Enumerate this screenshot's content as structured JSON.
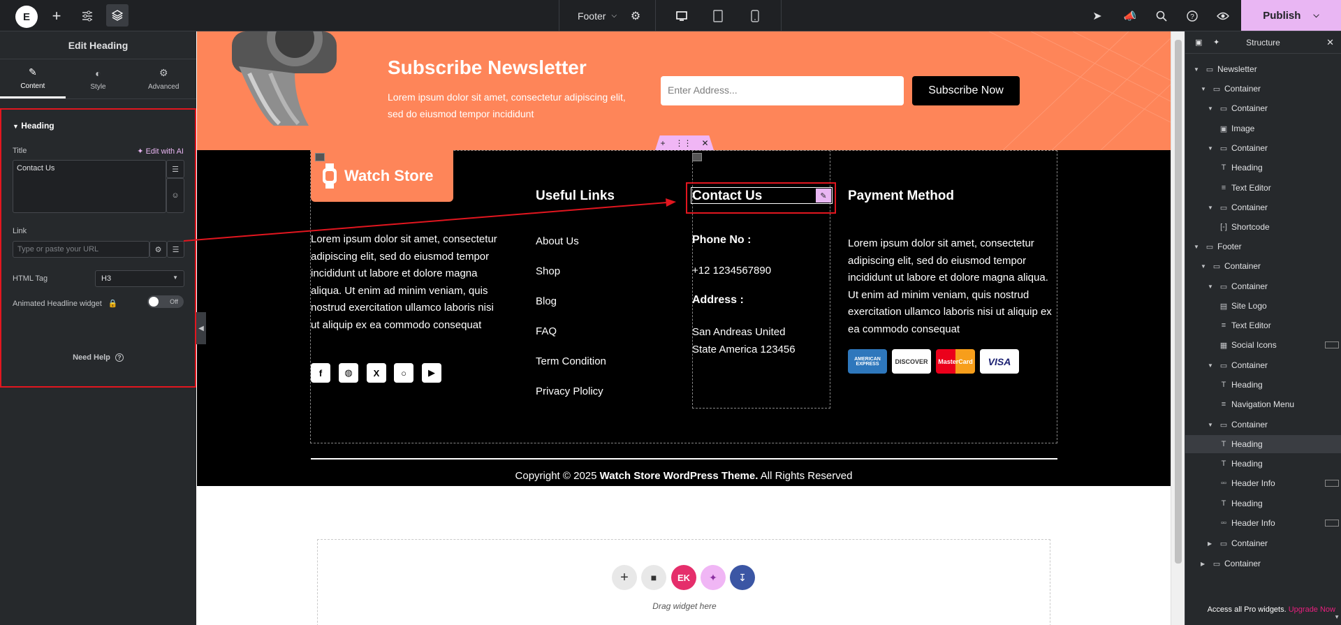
{
  "topbar": {
    "document_name": "Footer",
    "publish_label": "Publish"
  },
  "left_panel": {
    "title": "Edit Heading",
    "tabs": [
      {
        "label": "Content"
      },
      {
        "label": "Style"
      },
      {
        "label": "Advanced"
      }
    ],
    "section_title": "Heading",
    "title_label": "Title",
    "edit_ai_label": "Edit with AI",
    "title_value": "Contact Us",
    "link_label": "Link",
    "link_placeholder": "Type or paste your URL",
    "html_tag_label": "HTML Tag",
    "html_tag_value": "H3",
    "animated_label": "Animated Headline widget",
    "toggle_value": "Off",
    "need_help": "Need Help"
  },
  "structure": {
    "title": "Structure",
    "items": [
      {
        "label": "Newsletter"
      },
      {
        "label": "Container"
      },
      {
        "label": "Container"
      },
      {
        "label": "Image"
      },
      {
        "label": "Container"
      },
      {
        "label": "Heading"
      },
      {
        "label": "Text Editor"
      },
      {
        "label": "Container"
      },
      {
        "label": "Shortcode"
      },
      {
        "label": "Footer"
      },
      {
        "label": "Container"
      },
      {
        "label": "Container"
      },
      {
        "label": "Site Logo"
      },
      {
        "label": "Text Editor"
      },
      {
        "label": "Social Icons"
      },
      {
        "label": "Container"
      },
      {
        "label": "Heading"
      },
      {
        "label": "Navigation Menu"
      },
      {
        "label": "Container"
      },
      {
        "label": "Heading"
      },
      {
        "label": "Heading"
      },
      {
        "label": "Header Info"
      },
      {
        "label": "Heading"
      },
      {
        "label": "Header Info"
      },
      {
        "label": "Container"
      },
      {
        "label": "Container"
      }
    ],
    "footer_text": "Access all Pro widgets.",
    "upgrade_link": "Upgrade Now"
  },
  "newsletter": {
    "title": "Subscribe Newsletter",
    "text": "Lorem ipsum dolor sit amet, consectetur adipiscing elit, sed do eiusmod tempor incididunt",
    "input_placeholder": "Enter Address...",
    "button_label": "Subscribe Now"
  },
  "footer": {
    "logo_text": "Watch Store",
    "about_text": "Lorem ipsum dolor sit amet, consectetur adipiscing elit, sed do eiusmod tempor incididunt ut labore et dolore magna aliqua. Ut enim ad minim veniam, quis nostrud exercitation ullamco laboris nisi ut aliquip ex ea commodo consequat",
    "useful_links_title": "Useful Links",
    "links": [
      "About Us",
      "Shop",
      "Blog",
      "FAQ",
      "Term Condition",
      "Privacy Plolicy"
    ],
    "contact_title": "Contact Us",
    "phone_label": "Phone No :",
    "phone_value": "+12 1234567890",
    "address_label": "Address :",
    "address_value": "San Andreas United State America 123456",
    "payment_title": "Payment Method",
    "payment_text": "Lorem ipsum dolor sit amet, consectetur adipiscing elit, sed do eiusmod tempor incididunt ut labore et dolore magna aliqua. Ut enim ad minim veniam, quis nostrud exercitation ullamco laboris nisi ut aliquip ex ea commodo consequat",
    "cards": [
      "AMERICAN EXPRESS",
      "DISCOVER",
      "MasterCard",
      "VISA"
    ],
    "copyright_prefix": "Copyright © 2025",
    "copyright_brand": "Watch Store WordPress Theme.",
    "copyright_suffix": "All Rights Reserved"
  },
  "dropzone": {
    "label": "Drag widget here"
  },
  "colors": {
    "accent": "#e9b6f3",
    "newsletter_bg": "#fe8559",
    "highlight_red": "#e2161f",
    "upgrade_pink": "#e81f7e"
  }
}
